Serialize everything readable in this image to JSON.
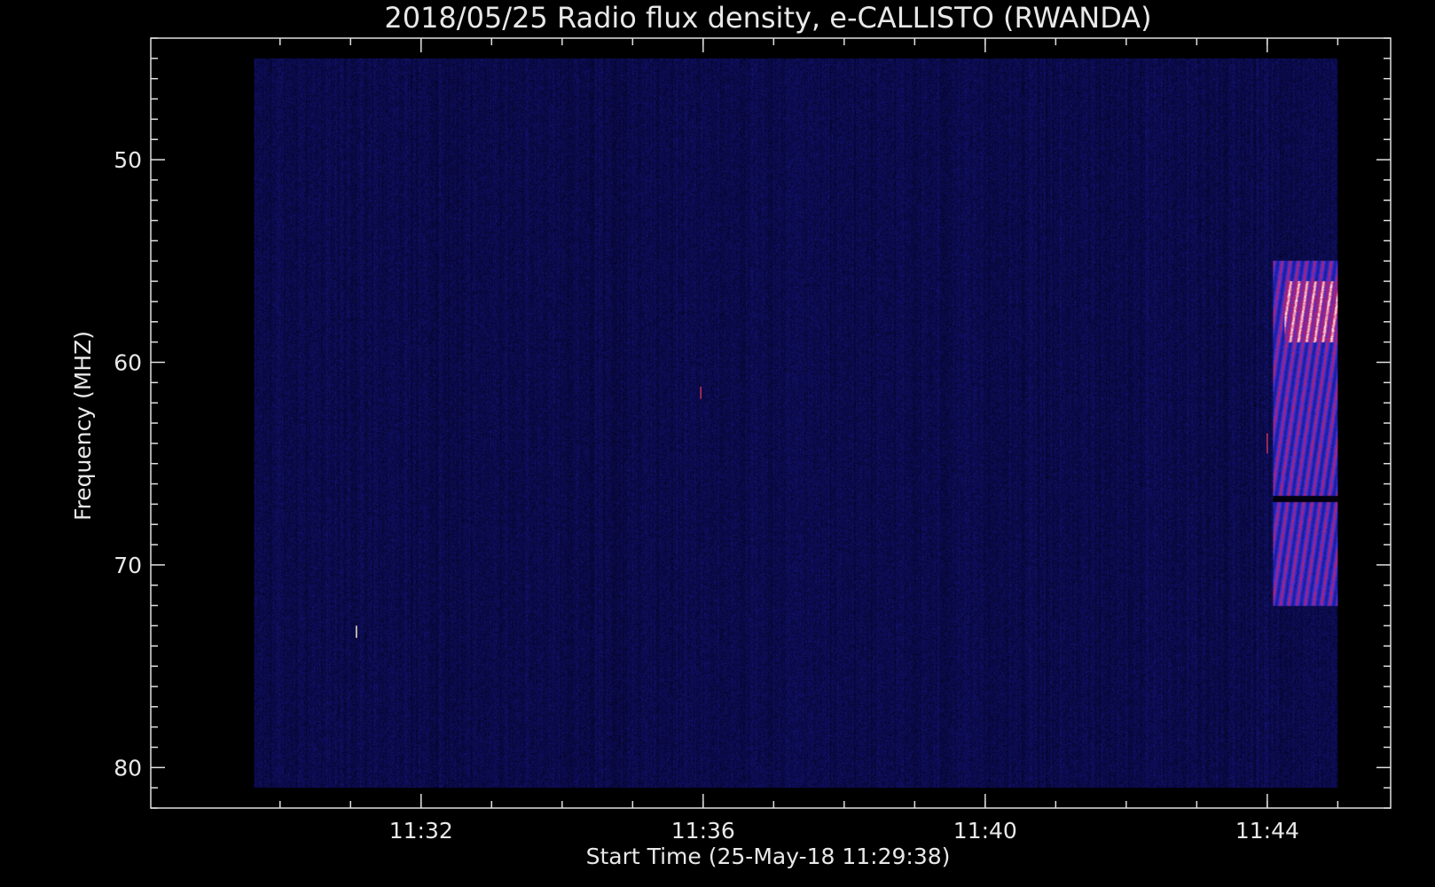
{
  "chart_data": {
    "type": "heatmap",
    "title": "2018/05/25  Radio flux density, e-CALLISTO (RWANDA)",
    "xlabel": "Start Time (25-May-18 11:29:38)",
    "ylabel": "Frequency (MHZ)",
    "x_axis": {
      "unit": "time",
      "range": [
        "11:29:38",
        "11:45:00"
      ],
      "view_range": [
        "11:28:10",
        "11:45:45"
      ],
      "major_ticks": [
        {
          "label": "11:32",
          "time": "11:32"
        },
        {
          "label": "11:36",
          "time": "11:36"
        },
        {
          "label": "11:40",
          "time": "11:40"
        },
        {
          "label": "11:44",
          "time": "11:44"
        }
      ],
      "minor_tick_times": [
        "11:30",
        "11:31",
        "11:32",
        "11:33",
        "11:34",
        "11:35",
        "11:36",
        "11:37",
        "11:38",
        "11:39",
        "11:40",
        "11:41",
        "11:42",
        "11:43",
        "11:44",
        "11:45"
      ]
    },
    "y_axis": {
      "unit": "MHz",
      "inverted": true,
      "data_range": [
        45,
        81
      ],
      "view_range": [
        44,
        82
      ],
      "major_ticks": [
        50,
        60,
        70,
        80
      ],
      "minor_step": 1
    },
    "colormap": [
      "#00000a",
      "#0a0a4a",
      "#1c1c96",
      "#3232e6",
      "#c81e5a",
      "#ffffff"
    ],
    "background_level": 0.2,
    "features": [
      {
        "kind": "burst",
        "time_start": "11:44:05",
        "time_end": "11:45:00",
        "freq_start": 55,
        "freq_end": 72,
        "intensity": 0.75
      },
      {
        "kind": "burst-core",
        "time_start": "11:44:15",
        "time_end": "11:45:00",
        "freq_start": 56,
        "freq_end": 59,
        "intensity": 0.95
      },
      {
        "kind": "dark-band",
        "time_start": "11:44:05",
        "time_end": "11:45:00",
        "freq_start": 66.6,
        "freq_end": 66.9,
        "intensity": 0.0
      },
      {
        "kind": "spike",
        "time": "11:35:58",
        "freq_start": 61.2,
        "freq_end": 61.8,
        "color": "#c8325a"
      },
      {
        "kind": "spike",
        "time": "11:31:05",
        "freq_start": 73.0,
        "freq_end": 73.6,
        "color": "#f0e6c8"
      },
      {
        "kind": "spike",
        "time": "11:44:00",
        "freq_start": 63.5,
        "freq_end": 64.5,
        "color": "#c8325a"
      }
    ]
  }
}
